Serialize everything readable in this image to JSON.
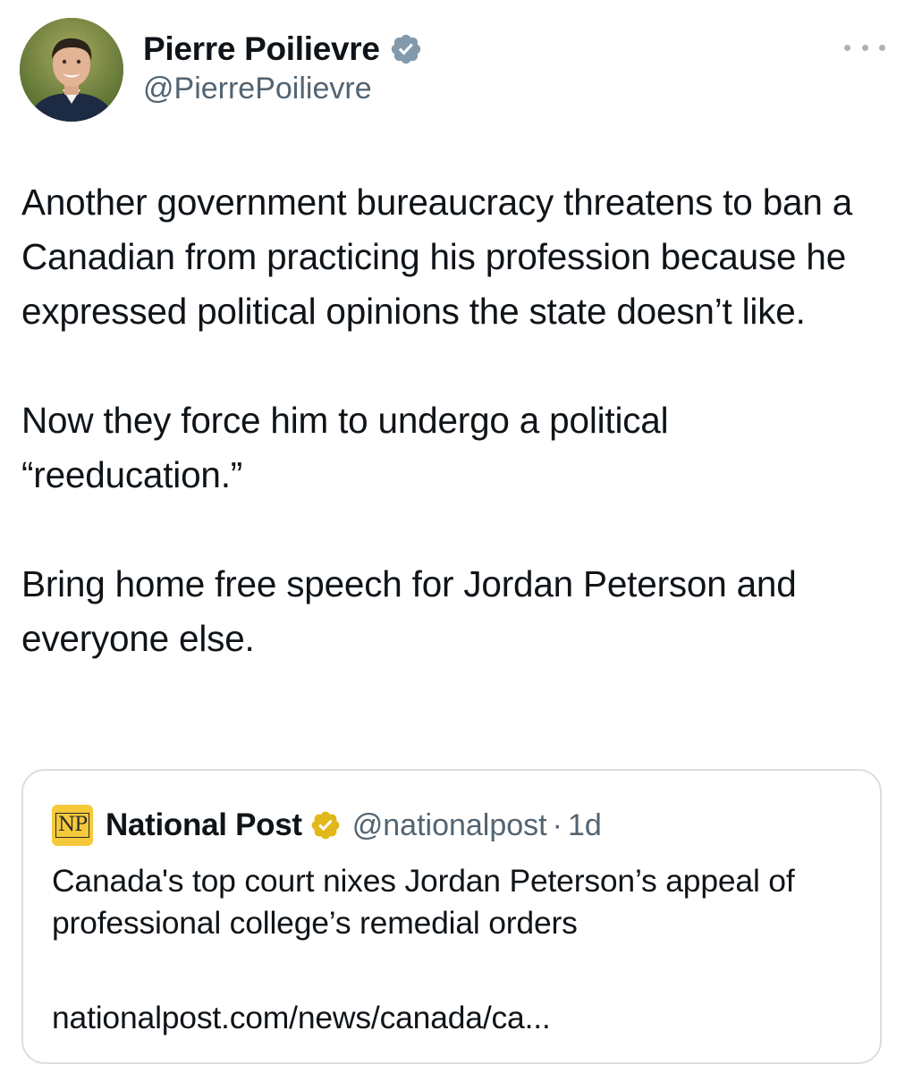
{
  "author": {
    "name": "Pierre Poilievre",
    "handle": "@PierrePoilievre",
    "verified_color": "#829aab",
    "avatar": "profile-photo"
  },
  "more_icon": "more-horizontal-icon",
  "tweet": {
    "paragraphs": [
      "Another government bureaucracy threatens to ban a Canadian from practicing his profession because he expressed political opinions the state doesn’t like.",
      "Now they force him to undergo a political “reeducation.”",
      "Bring home free speech for Jordan Peterson and everyone else."
    ]
  },
  "quote": {
    "logo_text": "NP",
    "logo_color": "#f5c93a",
    "name": "National Post",
    "verified_color": "#e2b719",
    "handle": "@nationalpost",
    "separator": "·",
    "time": "1d",
    "text": "Canada's top court nixes Jordan Peterson’s appeal of professional college’s remedial orders",
    "link": "nationalpost.com/news/canada/ca..."
  }
}
